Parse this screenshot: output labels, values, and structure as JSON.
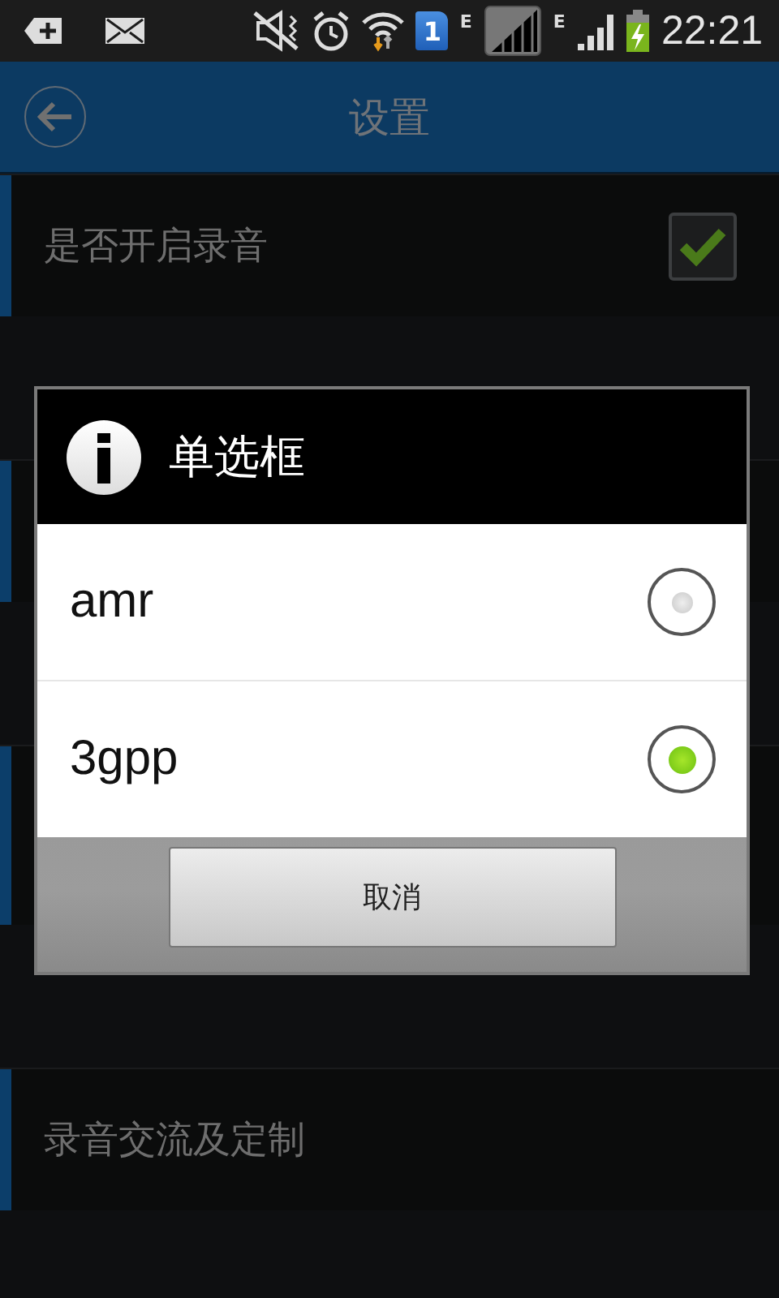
{
  "status_bar": {
    "sim_badge": "1",
    "network_labels": [
      "E",
      "E"
    ],
    "time": "22:21"
  },
  "title_bar": {
    "title": "设置"
  },
  "settings": [
    {
      "kind": "checkbox",
      "label": "是否开启录音",
      "checked": true
    },
    {
      "kind": "covered"
    },
    {
      "kind": "covered"
    },
    {
      "kind": "plain",
      "label": "录音交流及定制"
    }
  ],
  "dialog": {
    "title": "单选框",
    "options": [
      {
        "label": "amr",
        "selected": false
      },
      {
        "label": "3gpp",
        "selected": true
      }
    ],
    "buttons": [
      "取消"
    ]
  }
}
